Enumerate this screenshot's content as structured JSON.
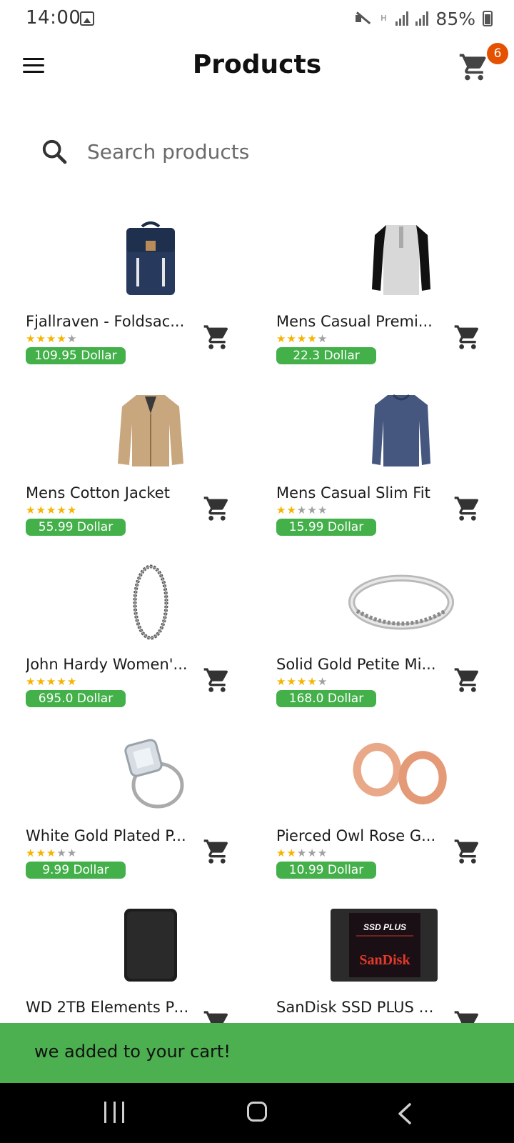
{
  "status_bar": {
    "time": "14:00",
    "battery": "85%",
    "data_indicator": "H"
  },
  "app_bar": {
    "title": "Products",
    "cart_count": "6"
  },
  "search": {
    "placeholder": "Search products"
  },
  "colors": {
    "price_badge": "#43b04a",
    "star": "#f5b400",
    "cart_badge": "#e65100",
    "snackbar": "#4caf50"
  },
  "products": [
    {
      "name": "Fjallraven - Foldsac...",
      "rating": 4,
      "price": "109.95 Dollar",
      "image": "backpack"
    },
    {
      "name": "Mens Casual Premi...",
      "rating": 4,
      "price": "22.3 Dollar",
      "image": "raglan-shirt"
    },
    {
      "name": "Mens Cotton Jacket",
      "rating": 5,
      "price": "55.99 Dollar",
      "image": "jacket"
    },
    {
      "name": "Mens Casual Slim Fit",
      "rating": 2,
      "price": "15.99 Dollar",
      "image": "longsleeve-shirt"
    },
    {
      "name": "John Hardy Women'...",
      "rating": 5,
      "price": "695.0 Dollar",
      "image": "dragon-bracelet"
    },
    {
      "name": "Solid Gold Petite Mi...",
      "rating": 4,
      "price": "168.0 Dollar",
      "image": "silver-ring"
    },
    {
      "name": "White Gold Plated P...",
      "rating": 3,
      "price": "9.99 Dollar",
      "image": "engagement-ring"
    },
    {
      "name": "Pierced Owl Rose G...",
      "rating": 2,
      "price": "10.99 Dollar",
      "image": "rose-gold-plugs"
    },
    {
      "name": "WD 2TB Elements Po...",
      "rating": 0,
      "price": "",
      "image": "external-drive"
    },
    {
      "name": "SanDisk SSD PLUS 1T...",
      "rating": 0,
      "price": "",
      "image": "ssd",
      "image_text": {
        "line1": "SSD PLUS",
        "line2": "SanDisk"
      }
    }
  ],
  "snackbar": {
    "message": "we added to your cart!"
  }
}
